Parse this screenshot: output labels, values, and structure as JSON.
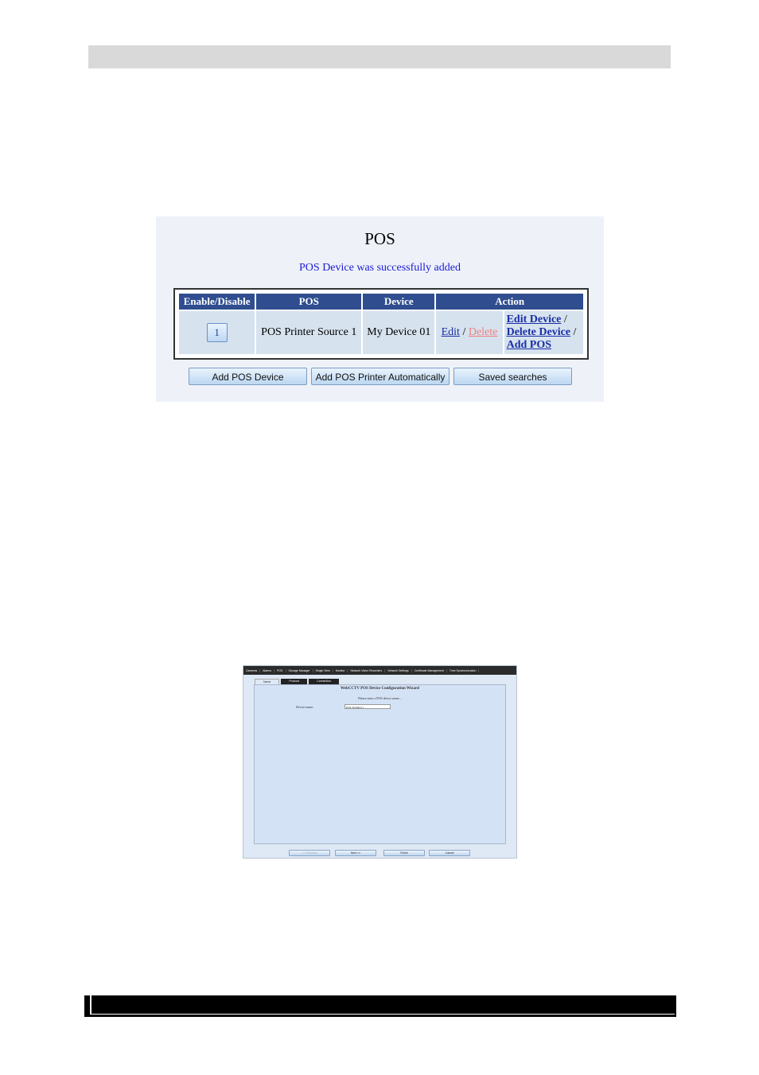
{
  "pos_panel": {
    "title": "POS",
    "message": "POS Device was successfully added",
    "table": {
      "headers": [
        "Enable/Disable",
        "POS",
        "Device",
        "Action"
      ],
      "row": {
        "toggle": "1",
        "pos": "POS Printer Source 1",
        "device": "My Device 01",
        "edit": "Edit",
        "separator": "/",
        "delete": "Delete",
        "edit_device": "Edit Device",
        "delete_device": "Delete Device",
        "add_pos": "Add POS"
      }
    },
    "buttons": {
      "add_pos_device": "Add POS Device",
      "add_pos_printer_auto": "Add POS Printer Automatically",
      "saved_searches": "Saved searches"
    },
    "colors": {
      "header_bg": "#2f4d8f",
      "message": "#1a1ad6",
      "delete_link": "#f08080"
    }
  },
  "wizard": {
    "nav": [
      "Cameras",
      "Alarms",
      "POS",
      "Storage Manager",
      "Single View",
      "Monitor",
      "Network Video Recorders",
      "Network Settings",
      "Certificate Management",
      "Time Synchronization"
    ],
    "tabs": [
      "Name",
      "Protocol",
      "Connection"
    ],
    "heading": "WebCCTV POS Device Configuration Wizard",
    "prompt": "Please enter a POS device name...",
    "device_name_label": "Device name:",
    "device_name_value": "POS Terminal 1",
    "buttons": {
      "previous": "<< Previous",
      "next": "Next >>",
      "finish": "Finish",
      "cancel": "Cancel"
    }
  }
}
